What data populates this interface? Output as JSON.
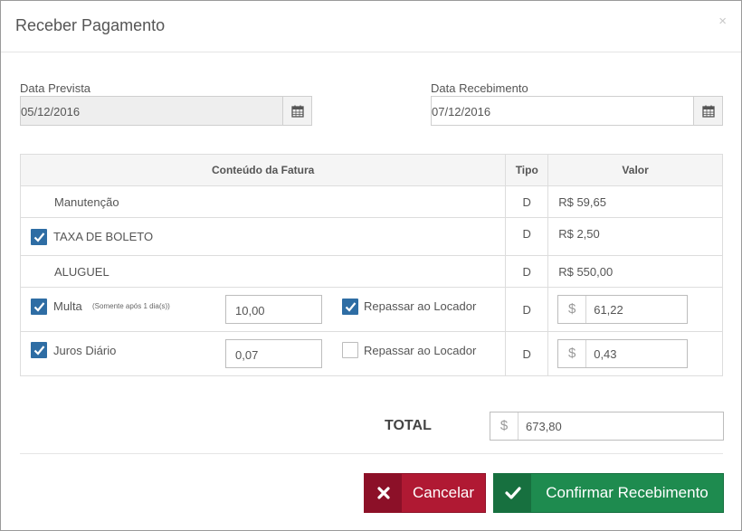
{
  "modal": {
    "title": "Receber Pagamento",
    "close": "×"
  },
  "dates": {
    "prevista_label": "Data Prevista",
    "prevista_value": "05/12/2016",
    "recebimento_label": "Data Recebimento",
    "recebimento_value": "07/12/2016"
  },
  "table": {
    "headers": [
      "Conteúdo da Fatura",
      "Tipo",
      "Valor"
    ],
    "rows": [
      {
        "label": "Manutenção",
        "tipo": "D",
        "valor": "R$ 59,65"
      },
      {
        "label": "TAXA DE BOLETO",
        "tipo": "D",
        "valor": "R$ 2,50",
        "checked": true
      },
      {
        "label": "ALUGUEL",
        "tipo": "D",
        "valor": "R$ 550,00"
      },
      {
        "label": "Multa",
        "note": "(Somente após 1 dia(s))",
        "input": "10,00",
        "repassar_label": "Repassar ao Locador",
        "repassar_checked": true,
        "tipo": "D",
        "currency": "$",
        "valor": "61,22",
        "checked": true
      },
      {
        "label": "Juros Diário",
        "input": "0,07",
        "repassar_label": "Repassar ao Locador",
        "repassar_checked": false,
        "tipo": "D",
        "currency": "$",
        "valor": "0,43",
        "checked": true
      }
    ]
  },
  "total": {
    "label": "TOTAL",
    "currency": "$",
    "value": "673,80"
  },
  "buttons": {
    "cancel": "Cancelar",
    "confirm": "Confirmar Recebimento"
  },
  "colors": {
    "cancel": "#b01933",
    "confirm": "#1e8b4f",
    "checkbox": "#2e6da4"
  }
}
